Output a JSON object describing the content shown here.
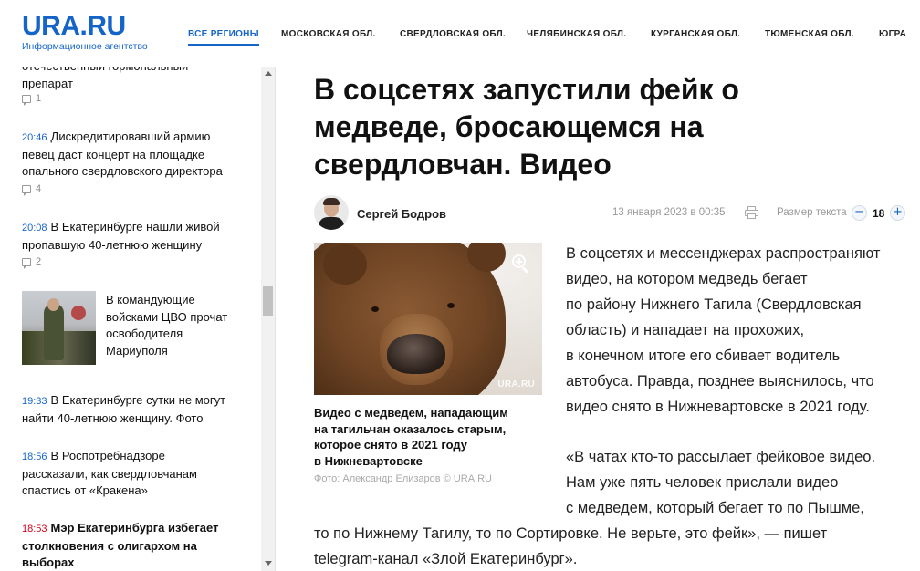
{
  "header": {
    "logo": "URA.RU",
    "logo_subtitle": "Информационное агентство",
    "nav": [
      "ВСЕ РЕГИОНЫ",
      "МОСКОВСКАЯ ОБЛ.",
      "СВЕРДЛОВСКАЯ ОБЛ.",
      "ЧЕЛЯБИНСКАЯ ОБЛ.",
      "КУРГАНСКАЯ ОБЛ.",
      "ТЮМЕНСКАЯ ОБЛ.",
      "ЮГРА"
    ],
    "active_nav": "ВСЕ РЕГИОНЫ"
  },
  "sidebar": {
    "items": [
      {
        "time": "",
        "title_lines": [
          "отечественный гормональный",
          "препарат"
        ],
        "comments": "1"
      },
      {
        "time": "20:46",
        "title_lines": [
          "Дискредитировавший армию",
          "певец даст концерт на площадке",
          "опального свердловского директора"
        ],
        "comments": "4"
      },
      {
        "time": "20:08",
        "title_lines": [
          "В Екатеринбурге нашли живой",
          "пропавшую 40-летнюю женщину"
        ],
        "comments": "2"
      },
      {
        "time": "",
        "title_lines": [
          "В командующие",
          "войсками ЦВО прочат",
          "освободителя",
          "Мариуполя"
        ],
        "comments": ""
      },
      {
        "time": "19:33",
        "title_lines": [
          "В Екатеринбурге сутки не могут",
          "найти 40-летнюю женщину. Фото"
        ],
        "comments": ""
      },
      {
        "time": "18:56",
        "title_lines": [
          "В Роспотребнадзоре",
          "рассказали, как свердловчанам",
          "спастись от «Кракена»"
        ],
        "comments": ""
      },
      {
        "time": "18:53",
        "title_lines": [
          "Мэр Екатеринбурга избегает",
          "столкновения с олигархом на",
          "выборах"
        ],
        "comments": ""
      }
    ]
  },
  "article": {
    "headline_lines": [
      "В соцсетях запустили фейк о",
      "медведе, бросающемся на",
      "свердловчан. Видео"
    ],
    "author": "Сергей Бодров",
    "date": "13 января 2023 в 00:35",
    "text_size_label": "Размер текста",
    "text_size": "18",
    "minus": "−",
    "plus": "+",
    "photo_watermark": "URA.RU",
    "caption_lines": [
      "Видео с медведем, нападающим",
      "на тагильчан оказалось старым,",
      "которое снято в 2021 году",
      "в Нижневартовске"
    ],
    "photo_credit": "Фото: Александр Елизаров © URA.RU",
    "para1_lines": [
      "В соцсетях и мессенджерах распространяют",
      "видео, на котором медведь бегает",
      "по району Нижнего Тагила (Свердловская",
      "область) и нападает на прохожих,",
      "в конечном итоге его сбивает водитель",
      "автобуса. Правда, позднее выяснилось, что",
      "видео снято в Нижневартовске в 2021 году."
    ],
    "para2_lines": [
      "«В чатах кто-то рассылает фейковое видео.",
      "Нам уже пять человек прислали видео",
      "с медведем, который бегает то по Пышме,",
      "то по Нижнему Тагилу, то по Сортировке. Не верьте, это фейк», — пишет",
      "telegram-канал «Злой Екатеринбург»."
    ]
  },
  "colors": {
    "brand": "#1565c9",
    "breaking": "#d0021b"
  }
}
